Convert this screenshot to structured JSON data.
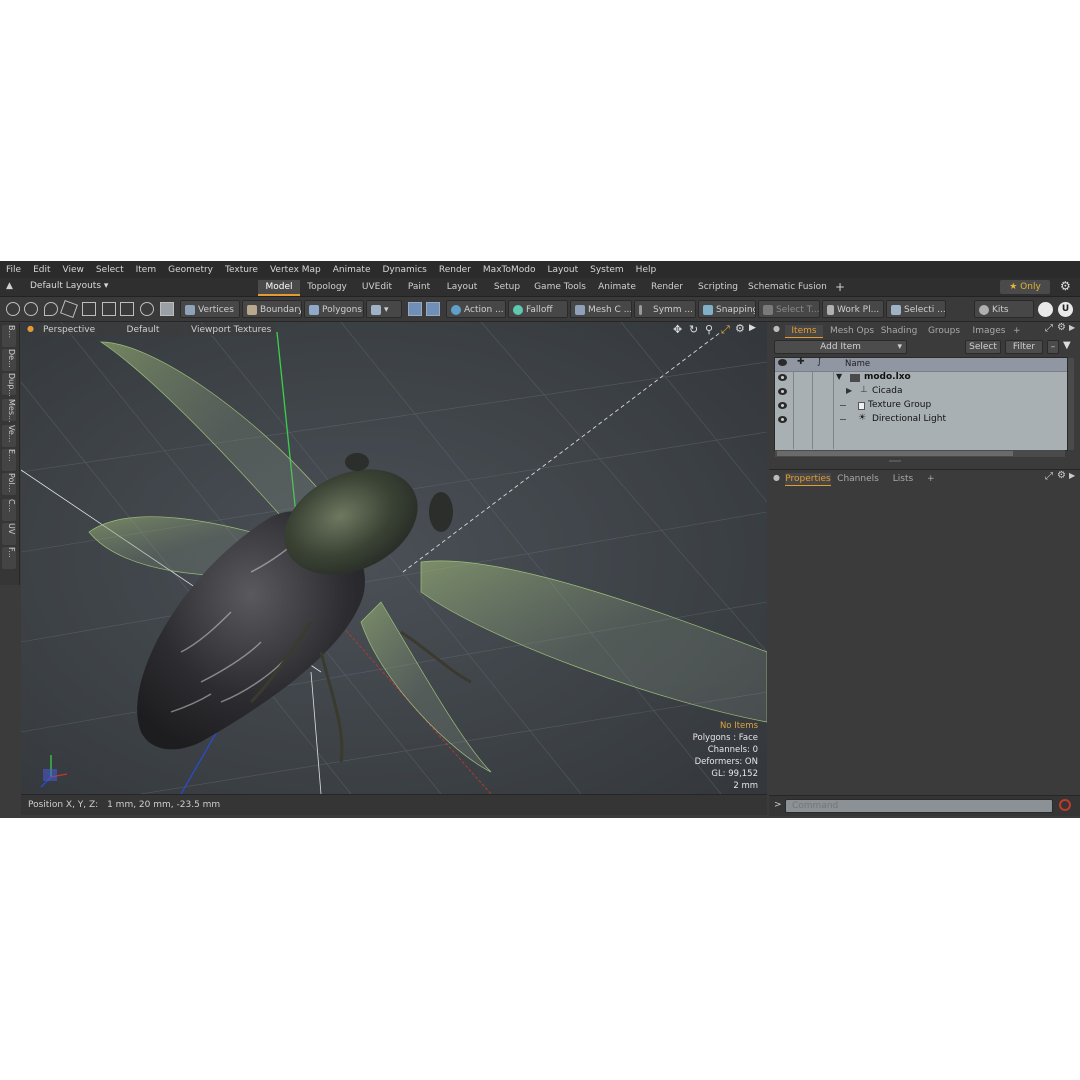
{
  "menu": [
    "File",
    "Edit",
    "View",
    "Select",
    "Item",
    "Geometry",
    "Texture",
    "Vertex Map",
    "Animate",
    "Dynamics",
    "Render",
    "MaxToModo",
    "Layout",
    "System",
    "Help"
  ],
  "layouts_label": "Default Layouts ▾",
  "workspace_tabs": [
    "Model",
    "Topology",
    "UVEdit",
    "Paint",
    "Layout",
    "Setup",
    "Game Tools",
    "Animate",
    "Render",
    "Scripting",
    "Schematic Fusion"
  ],
  "add_tab": "+",
  "only_label": "Only",
  "toolbar": {
    "vertices": "Vertices",
    "boundary": "Boundary",
    "polygons": "Polygons",
    "action": "Action",
    "action_more": "...",
    "falloff": "Falloff",
    "mesh": "Mesh C ...",
    "symm": "Symm ...",
    "snapping": "Snapping",
    "select_t": "Select T...",
    "work_pl": "Work Pl...",
    "selecti": "Selecti ...",
    "kits": "Kits"
  },
  "left_tabs": [
    "B...",
    "De...",
    "Dup...",
    "Mes...",
    "Ve...",
    "E...",
    "Pol...",
    "C...",
    "UV",
    "F..."
  ],
  "viewport": {
    "projection": "Perspective",
    "style": "Default",
    "textures": "Viewport Textures",
    "info": {
      "selection": "No Items",
      "polygons": "Polygons : Face",
      "channels": "Channels: 0",
      "deformers": "Deformers: ON",
      "gl": "GL: 99,152",
      "scale": "2 mm"
    }
  },
  "status": {
    "label": "Position X, Y, Z:",
    "value": "1 mm, 20 mm, -23.5 mm"
  },
  "items_panel": {
    "tabs": [
      "Items",
      "Mesh Ops",
      "Shading",
      "Groups",
      "Images"
    ],
    "add_tab": "+",
    "add_item": "Add Item",
    "select_btn": "Select",
    "filter_btn": "Filter",
    "col_name": "Name",
    "tree": [
      {
        "label": "modo.lxo"
      },
      {
        "label": "Cicada"
      },
      {
        "label": "Texture Group"
      },
      {
        "label": "Directional Light"
      }
    ]
  },
  "props_panel": {
    "tabs": [
      "Properties",
      "Channels",
      "Lists"
    ],
    "add_tab": "+"
  },
  "command": {
    "prompt": ">",
    "placeholder": "Command"
  },
  "colors": {
    "accent": "#e39b32",
    "viewport_bg": "#3e4348",
    "panel_bg": "#3b3b3b",
    "tree_bg": "#a9b0b4",
    "axis_x": "#c0392b",
    "axis_y": "#39d04a",
    "axis_z": "#2a4bd6"
  }
}
